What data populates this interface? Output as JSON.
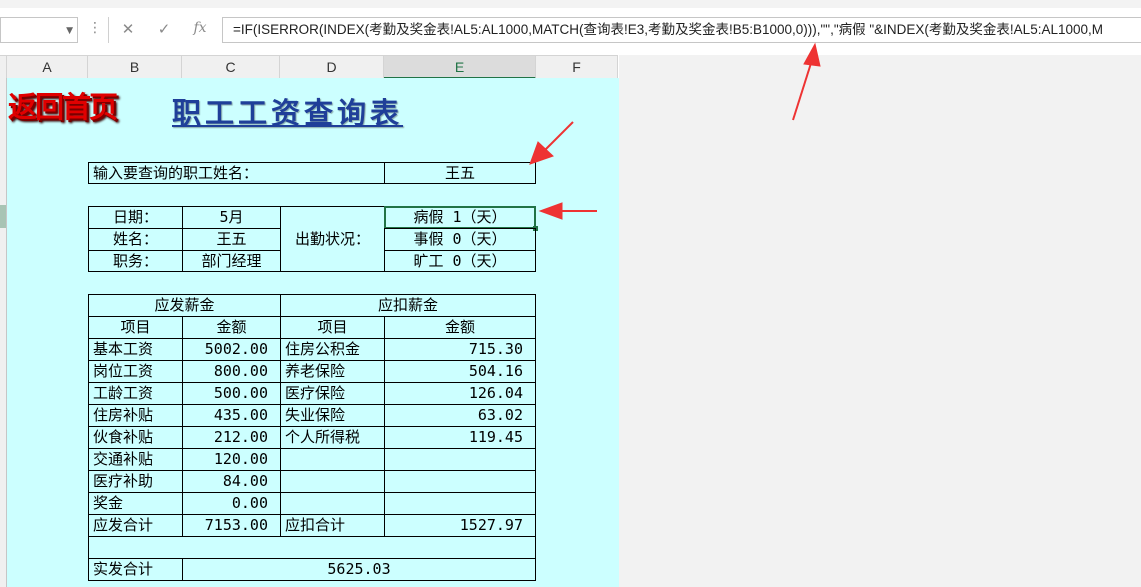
{
  "formula_bar": {
    "name_box": "",
    "cancel_icon": "✕",
    "enter_icon": "✓",
    "fx_label": "fx",
    "formula": "=IF(ISERROR(INDEX(考勤及奖金表!AL5:AL1000,MATCH(查询表!E3,考勤及奖金表!B5:B1000,0))),\"\",\"病假 \"&INDEX(考勤及奖金表!AL5:AL1000,M"
  },
  "columns": [
    "A",
    "B",
    "C",
    "D",
    "E",
    "F"
  ],
  "selected_column": "E",
  "back_link": "返回首页",
  "title": "职工工资查询表",
  "query": {
    "label": "输入要查询的职工姓名：",
    "value": "王五"
  },
  "info": {
    "date_label": "日期：",
    "date_value": "5月",
    "name_label": "姓名：",
    "name_value": "王五",
    "position_label": "职务：",
    "position_value": "部门经理",
    "attendance_label": "出勤状况：",
    "sick_leave": "病假 1（天）",
    "personal_leave": "事假 0（天）",
    "absence": "旷工 0（天）"
  },
  "salary": {
    "payable_header": "应发薪金",
    "deduction_header": "应扣薪金",
    "col_item": "项目",
    "col_amount": "金额",
    "payable_items": [
      {
        "item": "基本工资",
        "amount": "5002.00"
      },
      {
        "item": "岗位工资",
        "amount": "800.00"
      },
      {
        "item": "工龄工资",
        "amount": "500.00"
      },
      {
        "item": "住房补贴",
        "amount": "435.00"
      },
      {
        "item": "伙食补贴",
        "amount": "212.00"
      },
      {
        "item": "交通补贴",
        "amount": "120.00"
      },
      {
        "item": "医疗补助",
        "amount": "84.00"
      },
      {
        "item": "奖金",
        "amount": "0.00"
      }
    ],
    "deduction_items": [
      {
        "item": "住房公积金",
        "amount": "715.30"
      },
      {
        "item": "养老保险",
        "amount": "504.16"
      },
      {
        "item": "医疗保险",
        "amount": "126.04"
      },
      {
        "item": "失业保险",
        "amount": "63.02"
      },
      {
        "item": "个人所得税",
        "amount": "119.45"
      }
    ],
    "payable_total_label": "应发合计",
    "payable_total": "7153.00",
    "deduction_total_label": "应扣合计",
    "deduction_total": "1527.97",
    "net_label": "实发合计",
    "net_value": "5625.03"
  },
  "colors": {
    "sheet_bg": "#ccffff",
    "title": "#1f3f99",
    "back_link": "#e00000",
    "arrow": "#ee3333",
    "selection": "#217346"
  }
}
